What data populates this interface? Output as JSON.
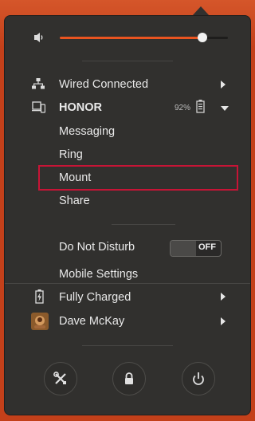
{
  "volume": {
    "level": 0.85,
    "icon": "speaker-icon"
  },
  "network": {
    "label": "Wired Connected",
    "icon": "network-wired-icon"
  },
  "device": {
    "name": "HONOR",
    "battery": "92%",
    "icon": "phone-laptop-icon",
    "menu": [
      "Messaging",
      "Ring",
      "Mount",
      "Share"
    ]
  },
  "dnd": {
    "label": "Do Not Disturb",
    "state": "OFF"
  },
  "mobile_settings": {
    "label": "Mobile Settings"
  },
  "battery": {
    "label": "Fully Charged",
    "icon": "battery-charging-icon"
  },
  "user": {
    "label": "Dave McKay",
    "icon": "avatar-icon"
  },
  "actions": [
    "settings-icon",
    "lock-icon",
    "power-icon"
  ],
  "colors": {
    "accent": "#e95420",
    "highlight": "#c71436",
    "panel": "#31302e"
  }
}
